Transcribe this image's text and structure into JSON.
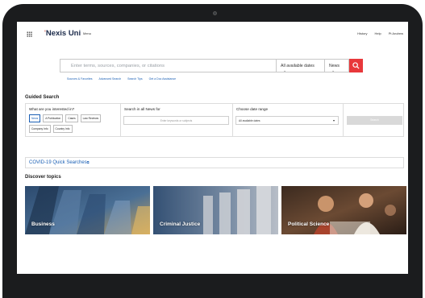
{
  "app": {
    "logo": "Nexis Uni",
    "menu_label": "Menu",
    "top_links": [
      "History",
      "Help",
      "Pt Andrew"
    ]
  },
  "search": {
    "placeholder": "Enter terms, sources, companies, or citations",
    "date_filter": "All available dates",
    "type_filter": "News",
    "links": [
      "Sources & Favorites",
      "Advanced Search",
      "Search Tips",
      "Get a Doc Assistance"
    ]
  },
  "guided_search": {
    "title": "Guided Search",
    "interest_question": "What are you interested in?",
    "chips": [
      "News",
      "A Publication",
      "Cases",
      "Law Reviews",
      "Company Info",
      "Country Info"
    ],
    "active_chip": "News",
    "search_label": "Search in all News for",
    "search_placeholder": "Enter keywords or subjects",
    "date_label": "Choose date range",
    "date_value": "All available dates",
    "search_button": "Search"
  },
  "covid_link": "COVID-19 Quick Searches",
  "discover": {
    "title": "Discover topics",
    "topics": [
      "Business",
      "Criminal Justice",
      "Political Science"
    ]
  },
  "colors": {
    "accent": "#e8383b",
    "link": "#1a5fb4",
    "bezel": "#1b1c1e"
  }
}
